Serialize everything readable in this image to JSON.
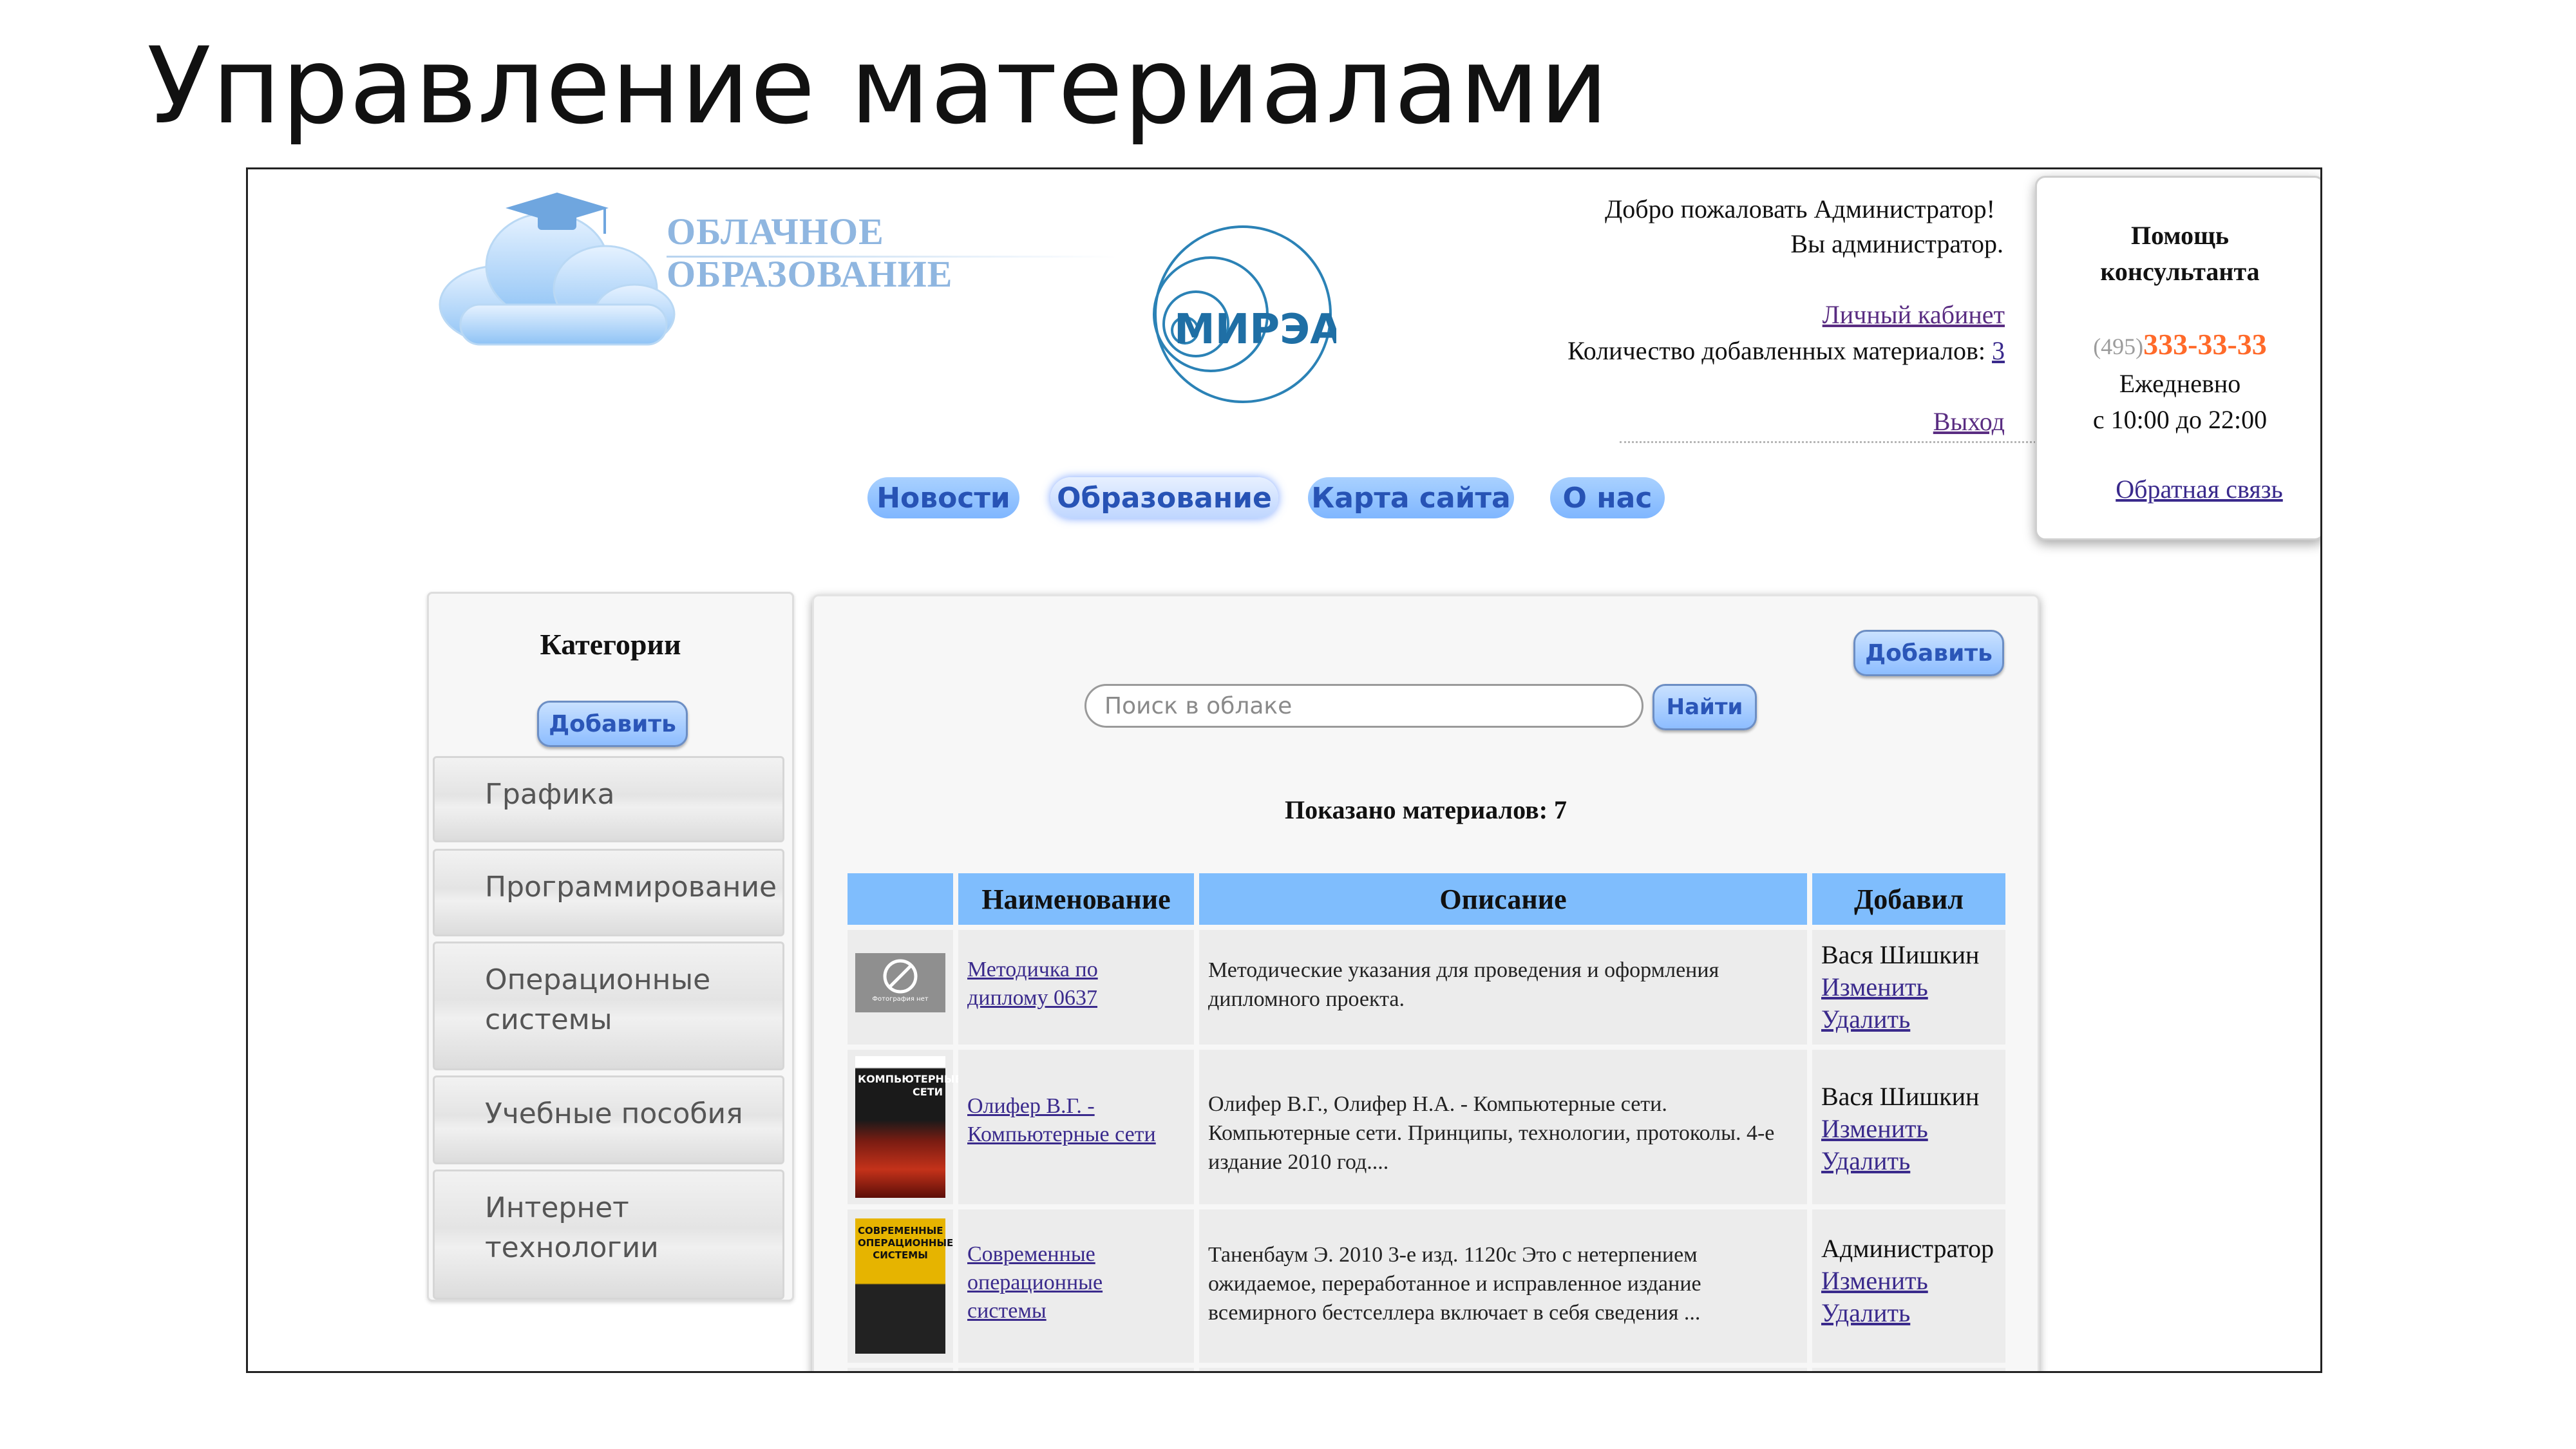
{
  "slide": {
    "title": "Управление материалами"
  },
  "site": {
    "logo_line1": "ОБЛАЧНОЕ",
    "logo_line2": "ОБРАЗОВАНИЕ",
    "partner_logo_text": "МИРЭА"
  },
  "header": {
    "welcome": "Добро пожаловать Администратор!",
    "role": "Вы администратор.",
    "cabinet_link": "Личный кабинет",
    "count_label": "Количество добавленных материалов:",
    "count_value": "3",
    "logout_link": "Выход"
  },
  "help_box": {
    "title_line1": "Помощь",
    "title_line2": "консультанта",
    "phone_code": "(495)",
    "phone_number": "333-33-33",
    "schedule_line1": "Ежедневно",
    "schedule_line2": "с 10:00 до 22:00",
    "feedback_link": "Обратная связь"
  },
  "nav": {
    "items": [
      {
        "label": "Новости"
      },
      {
        "label": "Образование"
      },
      {
        "label": "Карта сайта"
      },
      {
        "label": "О нас"
      }
    ],
    "active": "Образование"
  },
  "sidebar": {
    "title": "Категории",
    "add_button": "Добавить",
    "categories": [
      {
        "label": "Графика"
      },
      {
        "label": "Программирование"
      },
      {
        "label": "Операционные системы"
      },
      {
        "label": "Учебные пособия"
      },
      {
        "label": "Интернет технологии"
      }
    ]
  },
  "main": {
    "add_button": "Добавить",
    "search_placeholder": "Поиск в облаке",
    "search_value": "",
    "search_button": "Найти",
    "shown_label": "Показано материалов: 7",
    "columns": [
      "",
      "Наименование",
      "Описание",
      "Добавил"
    ],
    "rows": [
      {
        "thumb": "no-photo",
        "thumb_caption": "Фотография нет",
        "name": "Методичка по дипломy 0637",
        "description": "Методические указания для проведения и оформления дипломного проекта.",
        "author": "Вася Шишкин",
        "edit": "Изменить",
        "delete": "Удалить"
      },
      {
        "thumb": "book-networks",
        "thumb_title": "КОМПЬЮТЕРНЫЕ СЕТИ",
        "name": "Олифер В.Г. - Компьютерные сети",
        "description": "Олифер В.Г., Олифер Н.А. - Компьютерные сети. Компьютерные сети. Принципы, технологии, протоколы. 4-е издание 2010 год....",
        "author": "Вася Шишкин",
        "edit": "Изменить",
        "delete": "Удалить"
      },
      {
        "thumb": "book-os",
        "thumb_title": "СОВРЕМЕННЫЕ ОПЕРАЦИОННЫЕ СИСТЕМЫ",
        "name": "Современные операционные системы",
        "description": "Таненбаум Э. 2010 3-е изд. 1120с Это с нетерпением ожидаемое, переработанное и исправленное издание всемирного бестселлера включает в себя сведения ...",
        "author": "Администратор",
        "edit": "Изменить",
        "delete": "Удалить"
      }
    ]
  },
  "colors": {
    "table_header": "#7fbdfd",
    "nav_pill": "#8fc0ff",
    "phone_number": "#ff6a2a",
    "link": "#3a2a8c"
  }
}
